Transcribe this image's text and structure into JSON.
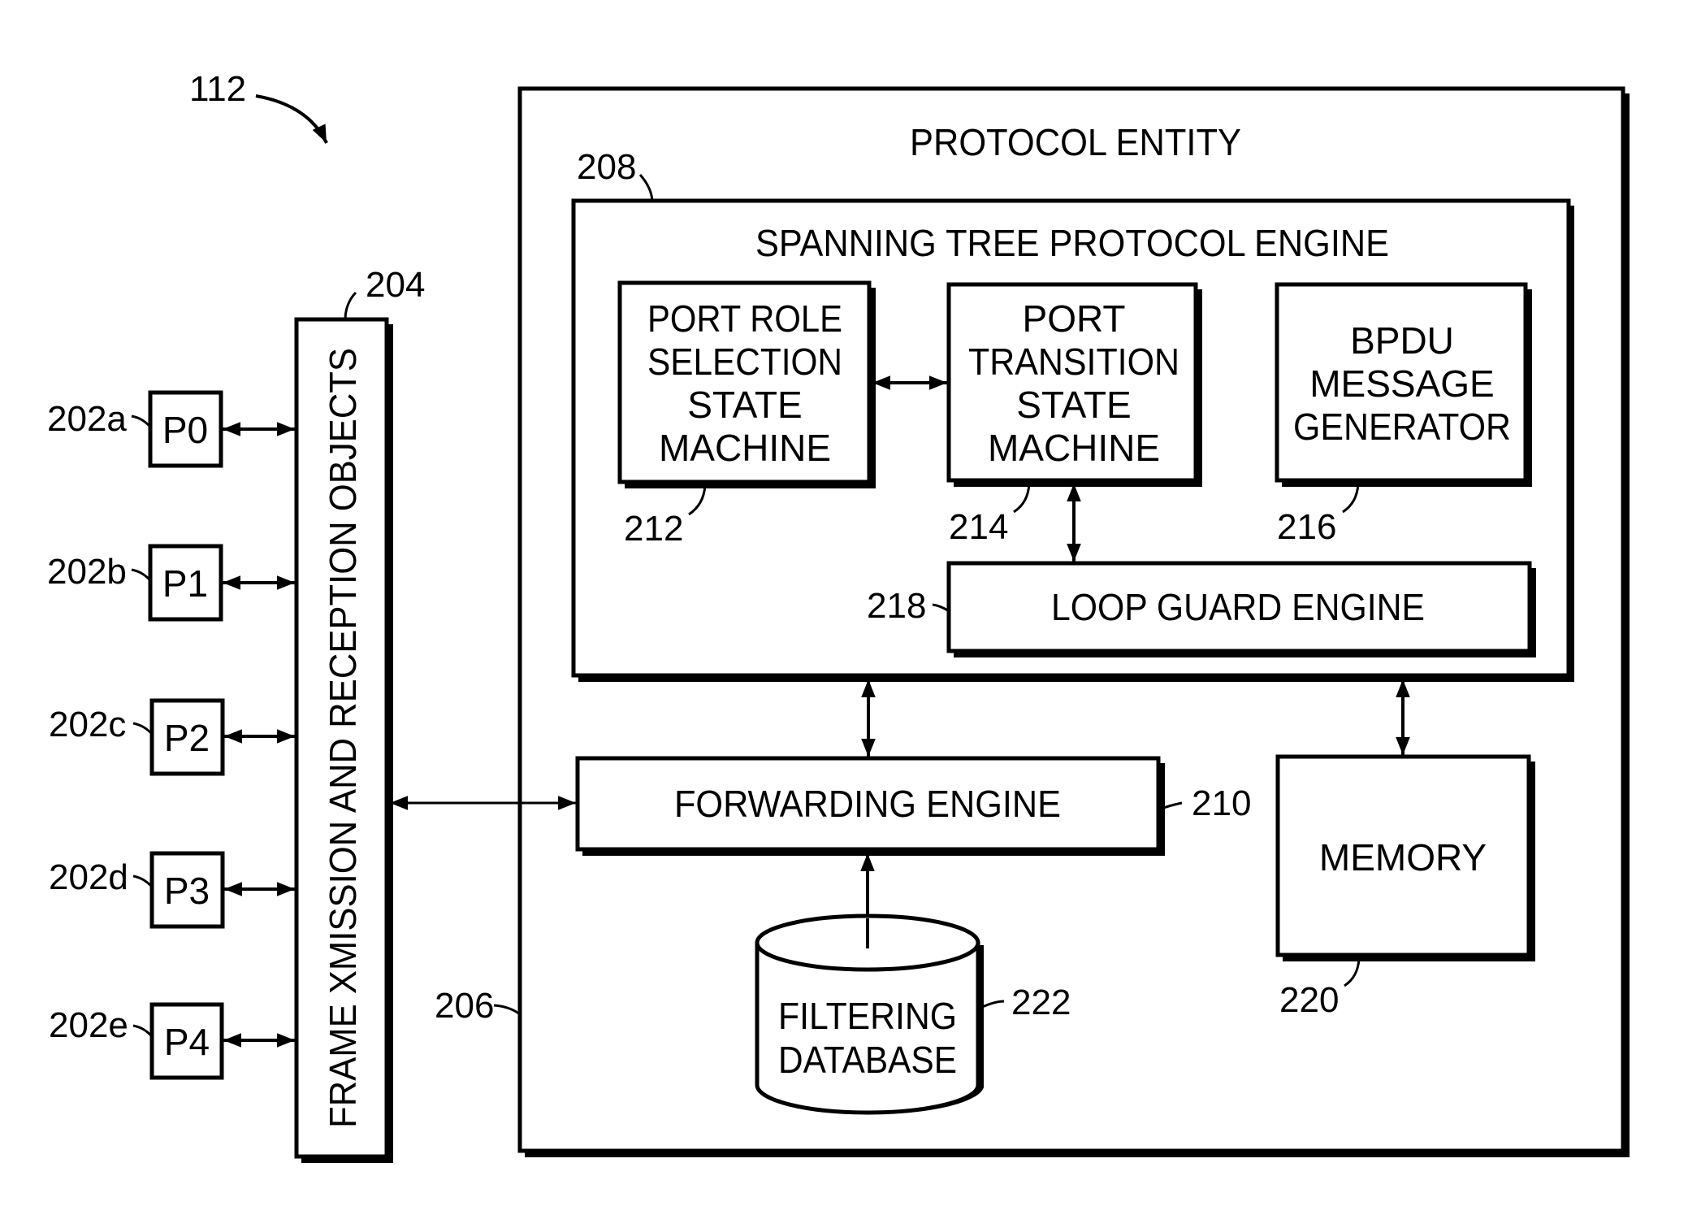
{
  "figure": {
    "reference": "112",
    "protocol_entity": {
      "title": "PROTOCOL ENTITY",
      "ref": "206"
    },
    "stp_engine": {
      "title": "SPANNING TREE PROTOCOL ENGINE",
      "ref": "208"
    },
    "port_role_sm": {
      "lines": [
        "PORT ROLE",
        "SELECTION",
        "STATE",
        "MACHINE"
      ],
      "ref": "212"
    },
    "port_transition_sm": {
      "lines": [
        "PORT",
        "TRANSITION",
        "STATE",
        "MACHINE"
      ],
      "ref": "214"
    },
    "bpdu_generator": {
      "lines": [
        "BPDU",
        "MESSAGE",
        "GENERATOR"
      ],
      "ref": "216"
    },
    "loop_guard": {
      "label": "LOOP GUARD ENGINE",
      "ref": "218"
    },
    "forwarding_engine": {
      "label": "FORWARDING ENGINE",
      "ref": "210"
    },
    "memory": {
      "label": "MEMORY",
      "ref": "220"
    },
    "filtering_db": {
      "lines": [
        "FILTERING",
        "DATABASE"
      ],
      "ref": "222"
    },
    "frame_objects": {
      "label": "FRAME XMISSION AND RECEPTION OBJECTS",
      "ref": "204"
    },
    "ports": [
      {
        "label": "P0",
        "ref": "202a"
      },
      {
        "label": "P1",
        "ref": "202b"
      },
      {
        "label": "P2",
        "ref": "202c"
      },
      {
        "label": "P3",
        "ref": "202d"
      },
      {
        "label": "P4",
        "ref": "202e"
      }
    ]
  }
}
